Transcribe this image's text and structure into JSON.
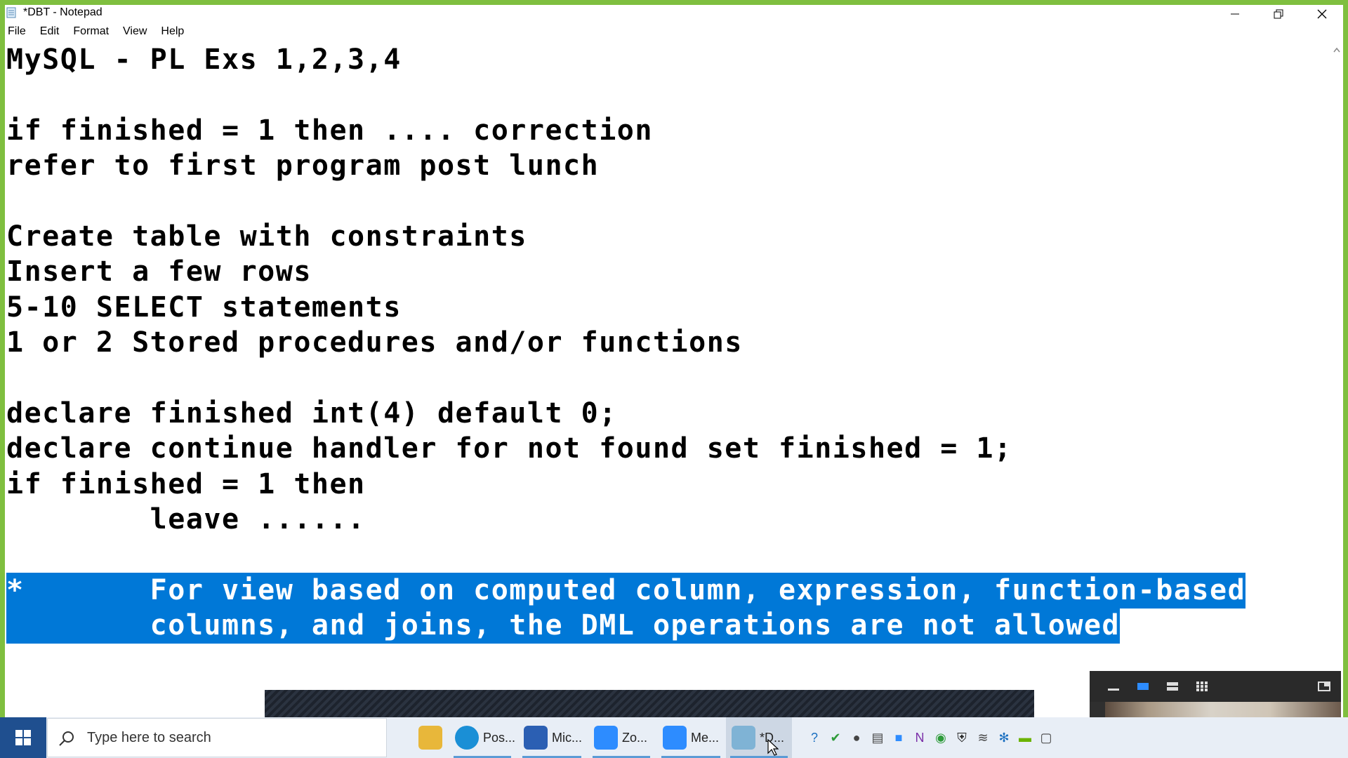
{
  "window": {
    "title": "*DBT - Notepad"
  },
  "menu": [
    "File",
    "Edit",
    "Format",
    "View",
    "Help"
  ],
  "editor": {
    "lines": [
      "MySQL - PL Exs 1,2,3,4",
      "if finished = 1 then .... correction",
      "refer to first program post lunch",
      "Create table with constraints",
      "Insert a few rows",
      "5-10 SELECT statements",
      "1 or 2 Stored procedures and/or functions",
      "declare finished int(4) default 0;",
      "declare continue handler for not found set finished = 1;",
      "if finished = 1 then",
      "        leave ......",
      "*       For view based on computed column, expression, function-based",
      "        columns, and joins, the DML operations are not allowed"
    ],
    "selected_lines": [
      11,
      12
    ]
  },
  "taskbar": {
    "search_placeholder": "Type here to search",
    "apps": [
      {
        "label": "",
        "icon": "file-explorer-icon",
        "color": "#e8b73a"
      },
      {
        "label": "Pos...",
        "icon": "edge-icon",
        "color": "#1a8fd6"
      },
      {
        "label": "Mic...",
        "icon": "whiteboard-icon",
        "color": "#2b5fb3"
      },
      {
        "label": "Zo...",
        "icon": "zoom-icon",
        "color": "#2d8cff"
      },
      {
        "label": "Me...",
        "icon": "zoom-meeting-icon",
        "color": "#2d8cff"
      },
      {
        "label": "*D...",
        "icon": "notepad-icon",
        "color": "#7fb3d5"
      }
    ]
  }
}
